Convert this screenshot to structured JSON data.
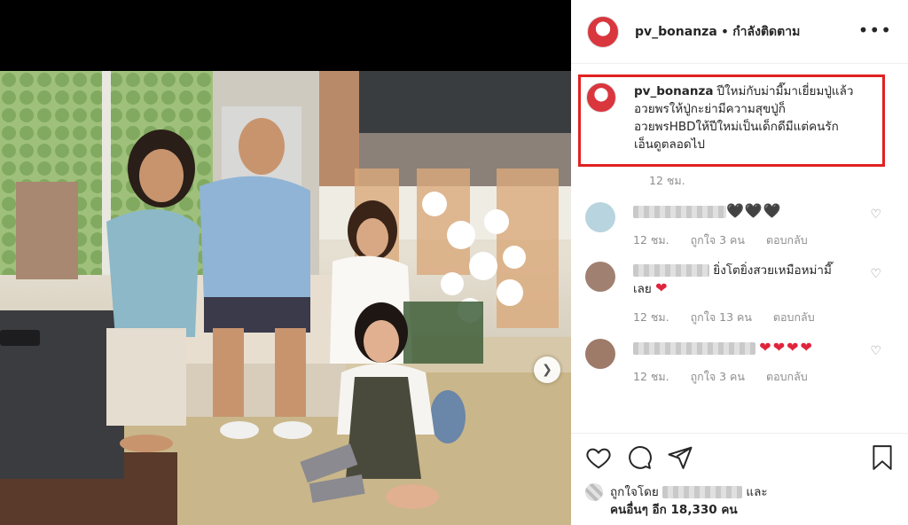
{
  "post": {
    "username": "pv_bonanza",
    "dot": "•",
    "follow_status": "กำลังติดตาม",
    "caption_lines": [
      "ปีใหม่กับม่ามี๊มาเยี่ยมปู่แล้ว",
      "อวยพรให้ปู่กะย่ามีความสุขปู่ก็",
      "อวยพรHBDให้ปีใหม่เป็นเด็กดีมีแต่คนรัก",
      "เอ็นดูตลอดไป"
    ],
    "caption_time": "12 ชม."
  },
  "comments": [
    {
      "text": "",
      "emoji": "🖤🖤🖤",
      "time": "12 ชม.",
      "likes": "ถูกใจ 3 คน",
      "reply": "ตอบกลับ",
      "avatar_color": "#b8d4de"
    },
    {
      "text": "ยิ่งโตยิ่งสวยเหมือหม่ามี๊",
      "text2": "เลย",
      "emoji": "❤",
      "time": "12 ชม.",
      "likes": "ถูกใจ 13 คน",
      "reply": "ตอบกลับ",
      "avatar_color": "#a08070"
    },
    {
      "text": "",
      "emoji": "❤❤❤❤",
      "time": "12 ชม.",
      "likes": "ถูกใจ 3 คน",
      "reply": "ตอบกลับ",
      "avatar_color": "#9e7a68"
    }
  ],
  "actions": {
    "icons": [
      "heart-outline-icon",
      "comment-icon",
      "share-icon",
      "bookmark-icon"
    ],
    "liked_by_prefix": "ถูกใจโดย",
    "liked_by_and": "และ",
    "others_text": "คนอื่นๆ อีก 18,330 คน"
  },
  "colors": {
    "highlight_border": "#e12121",
    "muted": "#8e8e8e",
    "heart": "#e0243c"
  }
}
